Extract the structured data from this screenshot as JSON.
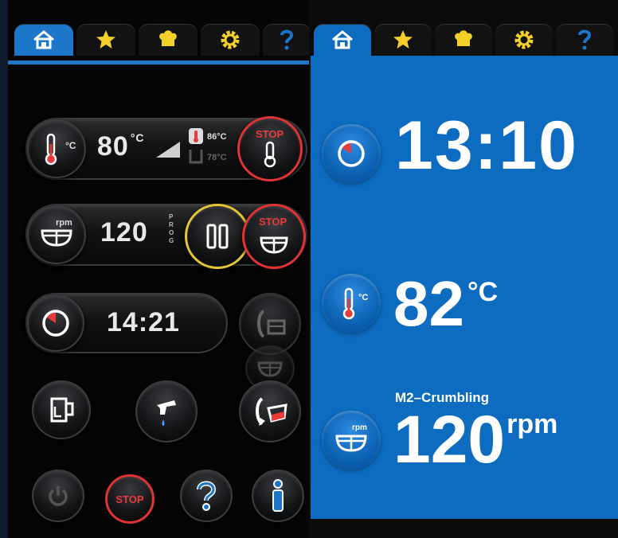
{
  "tabs": {
    "home": "home-icon",
    "favorites": "star-icon",
    "recipes": "chef-hat-icon",
    "settings": "gear-icon",
    "help": "question-icon"
  },
  "left": {
    "temperature": {
      "value": "80",
      "unit": "°C",
      "icon_unit": "°C",
      "bowl_temp": "86°C",
      "lid_temp": "78°C",
      "stop_label": "STOP"
    },
    "speed": {
      "value": "120",
      "icon_unit": "rpm",
      "prog_label": "PROG",
      "stop_label": "STOP"
    },
    "timer": {
      "value": "14:21"
    },
    "bottom": {
      "stop_label": "STOP"
    }
  },
  "right": {
    "timer": {
      "value": "13:10"
    },
    "temperature": {
      "value": "82",
      "unit": "°C",
      "icon_unit": "°C"
    },
    "speed": {
      "program": "M2–Crumbling",
      "value": "120",
      "unit": "rpm",
      "icon_unit": "rpm"
    }
  },
  "colors": {
    "accent": "#1d77c9",
    "stop": "#e83b3b",
    "pause": "#e4c53a",
    "right_bg": "#0d6cc0"
  }
}
